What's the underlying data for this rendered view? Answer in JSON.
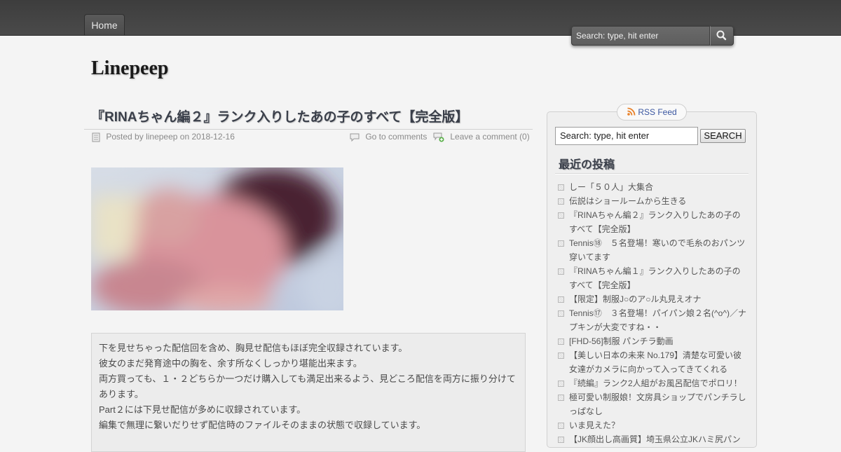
{
  "nav": {
    "home_label": "Home"
  },
  "top_search": {
    "placeholder": "Search: type, hit enter"
  },
  "site": {
    "title": "Linepeep"
  },
  "post": {
    "title": "『RINAちゃん編２』ランク入りしたあの子のすべて【完全版】",
    "meta": {
      "posted_by_prefix": "Posted by",
      "author": "linepeep",
      "on": "on",
      "date": "2018-12-16",
      "go_to_comments": "Go to comments",
      "leave_comment": "Leave a comment (0)"
    },
    "body": [
      "下を見せちゃった配信回を含め、胸見せ配信もほぼ完全収録されています。",
      "彼女のまだ発育途中の胸を、余す所なくしっかり堪能出来ます。",
      "両方買っても、１・２どちらか一つだけ購入しても満足出来るよう、見どころ配信を両方に振り分けてあります。",
      "Part２には下見せ配信が多めに収録されています。",
      "編集で無理に繋いだりせず配信時のファイルそのままの状態で収録しています。"
    ]
  },
  "sidebar": {
    "rss_label": "RSS Feed",
    "search_placeholder": "Search: type, hit enter",
    "search_button": "SEARCH",
    "recent_heading": "最近の投稿",
    "recent_posts": [
      "しー「５０人」大集合",
      "伝説はショールームから生きる",
      "『RINAちゃん編２』ランク入りしたあの子のすべて【完全版】",
      "Tennis⑱　５名登場！寒いので毛糸のおパンツ穿いてます",
      "『RINAちゃん編１』ランク入りしたあの子のすべて【完全版】",
      "【限定】制服J○のア○ル丸見えオナ",
      "Tennis⑰　３名登場！パイパン娘２名(^o^)／ナプキンが大変ですね・・",
      "[FHD-56]制服 パンチラ動画",
      "【美しい日本の未来 No.179】清楚な可愛い彼女達がカメラに向かって入ってきてくれる",
      "『続編』ランク2人組がお風呂配信でポロリ！",
      "極可愛い制服娘！文房具ショップでパンチラしっぱなし",
      "いま見えた？",
      "【JK顔出し高画質】埼玉県公立JKハミ尻パン"
    ]
  }
}
